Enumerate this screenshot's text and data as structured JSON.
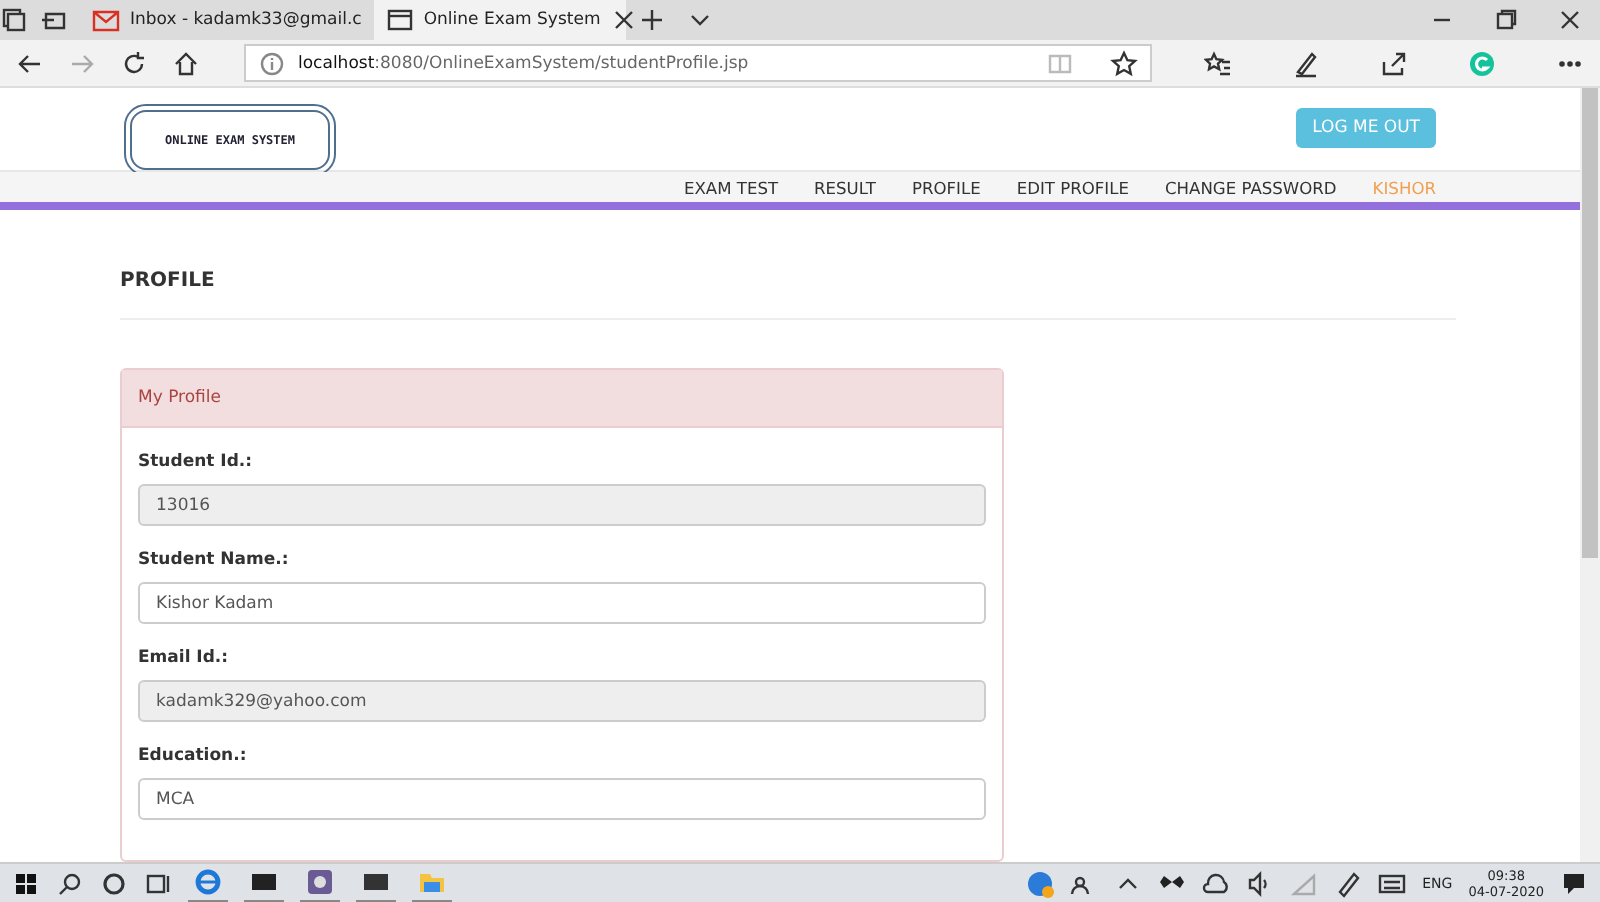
{
  "browser": {
    "tabs": [
      {
        "title": "Inbox - kadamk33@gmail.c",
        "kind": "mail",
        "selected": false
      },
      {
        "title": "Online Exam System",
        "kind": "page",
        "selected": true
      }
    ],
    "url_host": "localhost",
    "url_path": ":8080/OnlineExamSystem/studentProfile.jsp"
  },
  "site": {
    "logo_text": "ONLINE EXAM SYSTEM",
    "logout_button": "LOG ME OUT",
    "nav": [
      {
        "label": "EXAM TEST",
        "kind": "link"
      },
      {
        "label": "RESULT",
        "kind": "link"
      },
      {
        "label": "PROFILE",
        "kind": "link"
      },
      {
        "label": "EDIT PROFILE",
        "kind": "link"
      },
      {
        "label": "CHANGE PASSWORD",
        "kind": "link"
      },
      {
        "label": "KISHOR",
        "kind": "user"
      }
    ]
  },
  "page_heading": "PROFILE",
  "panel": {
    "title": "My Profile",
    "fields": [
      {
        "label": "Student Id.:",
        "value": "13016",
        "disabled": true
      },
      {
        "label": "Student Name.:",
        "value": "Kishor Kadam",
        "disabled": false
      },
      {
        "label": "Email Id.:",
        "value": "kadamk329@yahoo.com",
        "disabled": true
      },
      {
        "label": "Education.:",
        "value": "MCA",
        "disabled": false
      }
    ]
  },
  "taskbar": {
    "language": "ENG",
    "time": "09:38",
    "date": "04-07-2020"
  }
}
